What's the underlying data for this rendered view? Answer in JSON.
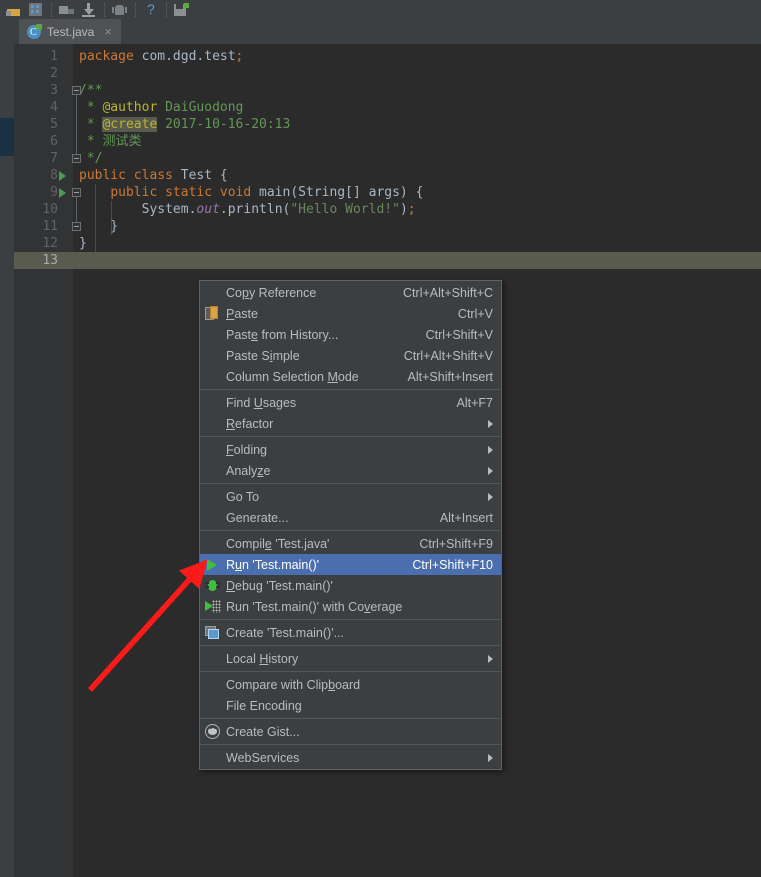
{
  "window": {
    "background": "#3c3f41",
    "editor_background": "#2b2b2b",
    "accent_selection": "#4b6eaf",
    "caret_line_color": "#5a5b4f"
  },
  "toolbar": {
    "icons": [
      "open-project-icon",
      "project-structure-icon",
      "sync-icon",
      "download-icon",
      "android-device-icon",
      "help-icon",
      "save-all-icon"
    ]
  },
  "left_stripe": {
    "tabs": [
      {
        "name": "structure-tool-window",
        "selected": false
      },
      {
        "name": "project-tool-window",
        "selected": true
      }
    ]
  },
  "editor_tabs": [
    {
      "label": "Test.java",
      "icon": "java-class-icon",
      "close_label": "×",
      "active": true
    }
  ],
  "editor": {
    "caret_line": 13,
    "lines": [
      {
        "n": "1",
        "tokens": [
          {
            "t": "package ",
            "c": "kw"
          },
          {
            "t": "com.dgd.test",
            "c": "plain"
          },
          {
            "t": ";",
            "c": "semi"
          }
        ]
      },
      {
        "n": "2",
        "tokens": []
      },
      {
        "n": "3",
        "tokens": [
          {
            "t": "/**",
            "c": "doc"
          }
        ]
      },
      {
        "n": "4",
        "tokens": [
          {
            "t": " * ",
            "c": "doc"
          },
          {
            "t": "@author",
            "c": "tag"
          },
          {
            "t": " DaiGuodong",
            "c": "doc"
          }
        ]
      },
      {
        "n": "5",
        "tokens": [
          {
            "t": " * ",
            "c": "doc"
          },
          {
            "t": "@create",
            "c": "tag-hl"
          },
          {
            "t": " 2017-10-16-20:13",
            "c": "doc"
          }
        ]
      },
      {
        "n": "6",
        "tokens": [
          {
            "t": " * 测试类",
            "c": "doc"
          }
        ]
      },
      {
        "n": "7",
        "tokens": [
          {
            "t": " */",
            "c": "doc"
          }
        ]
      },
      {
        "n": "8",
        "tokens": [
          {
            "t": "public class ",
            "c": "kw"
          },
          {
            "t": "Test",
            "c": "cls"
          },
          {
            "t": " {",
            "c": "plain"
          }
        ]
      },
      {
        "n": "9",
        "tokens": [
          {
            "t": "    ",
            "c": "plain"
          },
          {
            "t": "public static void ",
            "c": "kw"
          },
          {
            "t": "main",
            "c": "mag"
          },
          {
            "t": "(",
            "c": "plain"
          },
          {
            "t": "String",
            "c": "cls"
          },
          {
            "t": "[] args) {",
            "c": "plain"
          }
        ]
      },
      {
        "n": "10",
        "tokens": [
          {
            "t": "        ",
            "c": "plain"
          },
          {
            "t": "System",
            "c": "cls"
          },
          {
            "t": ".",
            "c": "plain"
          },
          {
            "t": "out",
            "c": "fld"
          },
          {
            "t": ".println(",
            "c": "plain"
          },
          {
            "t": "\"Hello World!\"",
            "c": "str"
          },
          {
            "t": ")",
            "c": "plain"
          },
          {
            "t": ";",
            "c": "semi"
          }
        ]
      },
      {
        "n": "11",
        "tokens": [
          {
            "t": "    }",
            "c": "plain"
          }
        ]
      },
      {
        "n": "12",
        "tokens": [
          {
            "t": "}",
            "c": "plain"
          }
        ]
      },
      {
        "n": "13",
        "tokens": []
      }
    ],
    "run_markers": [
      8,
      9
    ],
    "fold_markers": [
      3,
      7,
      9,
      11
    ]
  },
  "context_menu": {
    "items": [
      {
        "label": "Copy Reference",
        "mnemonic": "p",
        "shortcut": "Ctrl+Alt+Shift+C",
        "icon": null,
        "submenu": false,
        "selected": false
      },
      {
        "label": "Paste",
        "mnemonic": "P",
        "shortcut": "Ctrl+V",
        "icon": "paste-icon",
        "submenu": false,
        "selected": false
      },
      {
        "label": "Paste from History...",
        "mnemonic": "e",
        "shortcut": "Ctrl+Shift+V",
        "icon": null,
        "submenu": false,
        "selected": false
      },
      {
        "label": "Paste Simple",
        "mnemonic": "i",
        "shortcut": "Ctrl+Alt+Shift+V",
        "icon": null,
        "submenu": false,
        "selected": false
      },
      {
        "label": "Column Selection Mode",
        "mnemonic": "M",
        "shortcut": "Alt+Shift+Insert",
        "icon": null,
        "submenu": false,
        "selected": false
      },
      {
        "separator": true
      },
      {
        "label": "Find Usages",
        "mnemonic": "U",
        "shortcut": "Alt+F7",
        "icon": null,
        "submenu": false,
        "selected": false
      },
      {
        "label": "Refactor",
        "mnemonic": "R",
        "shortcut": "",
        "icon": null,
        "submenu": true,
        "selected": false
      },
      {
        "separator": true
      },
      {
        "label": "Folding",
        "mnemonic": "F",
        "shortcut": "",
        "icon": null,
        "submenu": true,
        "selected": false
      },
      {
        "label": "Analyze",
        "mnemonic": "z",
        "shortcut": "",
        "icon": null,
        "submenu": true,
        "selected": false
      },
      {
        "separator": true
      },
      {
        "label": "Go To",
        "mnemonic": "",
        "shortcut": "",
        "icon": null,
        "submenu": true,
        "selected": false
      },
      {
        "label": "Generate...",
        "mnemonic": "",
        "shortcut": "Alt+Insert",
        "icon": null,
        "submenu": false,
        "selected": false
      },
      {
        "separator": true
      },
      {
        "label": "Compile 'Test.java'",
        "mnemonic": "e",
        "shortcut": "Ctrl+Shift+F9",
        "icon": null,
        "submenu": false,
        "selected": false
      },
      {
        "label": "Run 'Test.main()'",
        "mnemonic": "u",
        "shortcut": "Ctrl+Shift+F10",
        "icon": "run-icon",
        "submenu": false,
        "selected": true
      },
      {
        "label": "Debug 'Test.main()'",
        "mnemonic": "D",
        "shortcut": "",
        "icon": "debug-icon",
        "submenu": false,
        "selected": false
      },
      {
        "label": "Run 'Test.main()' with Coverage",
        "mnemonic": "v",
        "shortcut": "",
        "icon": "coverage-icon",
        "submenu": false,
        "selected": false
      },
      {
        "separator": true
      },
      {
        "label": "Create 'Test.main()'...",
        "mnemonic": "",
        "shortcut": "",
        "icon": "create-config-icon",
        "submenu": false,
        "selected": false
      },
      {
        "separator": true
      },
      {
        "label": "Local History",
        "mnemonic": "H",
        "shortcut": "",
        "icon": null,
        "submenu": true,
        "selected": false
      },
      {
        "separator": true
      },
      {
        "label": "Compare with Clipboard",
        "mnemonic": "b",
        "shortcut": "",
        "icon": null,
        "submenu": false,
        "selected": false
      },
      {
        "label": "File Encoding",
        "mnemonic": "",
        "shortcut": "",
        "icon": null,
        "submenu": false,
        "selected": false
      },
      {
        "separator": true
      },
      {
        "label": "Create Gist...",
        "mnemonic": "",
        "shortcut": "",
        "icon": "gist-icon",
        "submenu": false,
        "selected": false
      },
      {
        "separator": true
      },
      {
        "label": "WebServices",
        "mnemonic": "",
        "shortcut": "",
        "icon": null,
        "submenu": true,
        "selected": false
      }
    ]
  },
  "annotation": {
    "arrow_color": "#ff1a1a",
    "points_to": "Run 'Test.main()'"
  }
}
